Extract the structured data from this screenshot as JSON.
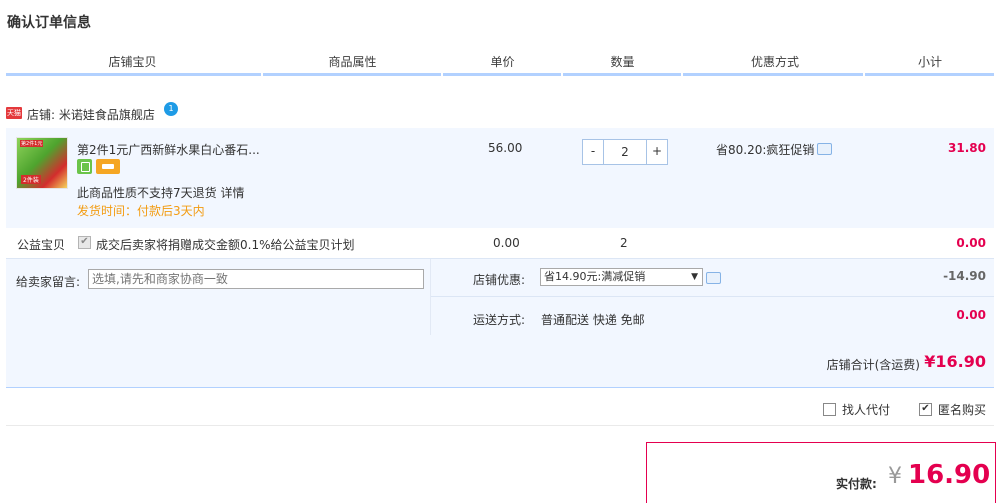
{
  "page": {
    "title": "确认订单信息"
  },
  "columns": [
    "店铺宝贝",
    "商品属性",
    "单价",
    "数量",
    "优惠方式",
    "小计"
  ],
  "shop": {
    "badge": "天猫",
    "label": "店铺: 米诺娃食品旗舰店",
    "ww": "1"
  },
  "item": {
    "thumb_top": "第2件1元",
    "thumb_bottom": "2件装",
    "name": "第2件1元广西新鲜水果白心番石...",
    "no_return": "此商品性质不支持7天退货",
    "detail_link": "详情",
    "ship_time": "发货时间：付款后3天内",
    "price": "56.00",
    "qty": "2",
    "qty_minus": "-",
    "qty_plus": "+",
    "promo": "省80.20:疯狂促销",
    "subtotal": "31.80"
  },
  "donation": {
    "label": "公益宝贝",
    "checkbox": "✔",
    "text": "成交后卖家将捐赠成交金额0.1%给公益宝贝计划",
    "price": "0.00",
    "qty": "2",
    "subtotal": "0.00"
  },
  "message": {
    "label": "给卖家留言:",
    "placeholder": "选填,请先和商家协商一致"
  },
  "discount": {
    "label": "店铺优惠:",
    "selected": "省14.90元:满减促销",
    "arrow": "▼",
    "value": "-14.90"
  },
  "shipping": {
    "label": "运送方式:",
    "value": "普通配送 快递 免邮",
    "fee": "0.00"
  },
  "shop_total": {
    "label": "店铺合计(含运费)",
    "value": "¥16.90"
  },
  "options": {
    "proxy_pay": "找人代付",
    "anonymous": "匿名购买",
    "checkmark": "✔"
  },
  "payment": {
    "label": "实付款:",
    "currency": "¥",
    "value": "16.90"
  },
  "colors": {
    "accent": "#e4004f",
    "header_line": "#b2d1ff",
    "row_bg": "#f2f7ff",
    "ship_time": "#f39c12"
  }
}
